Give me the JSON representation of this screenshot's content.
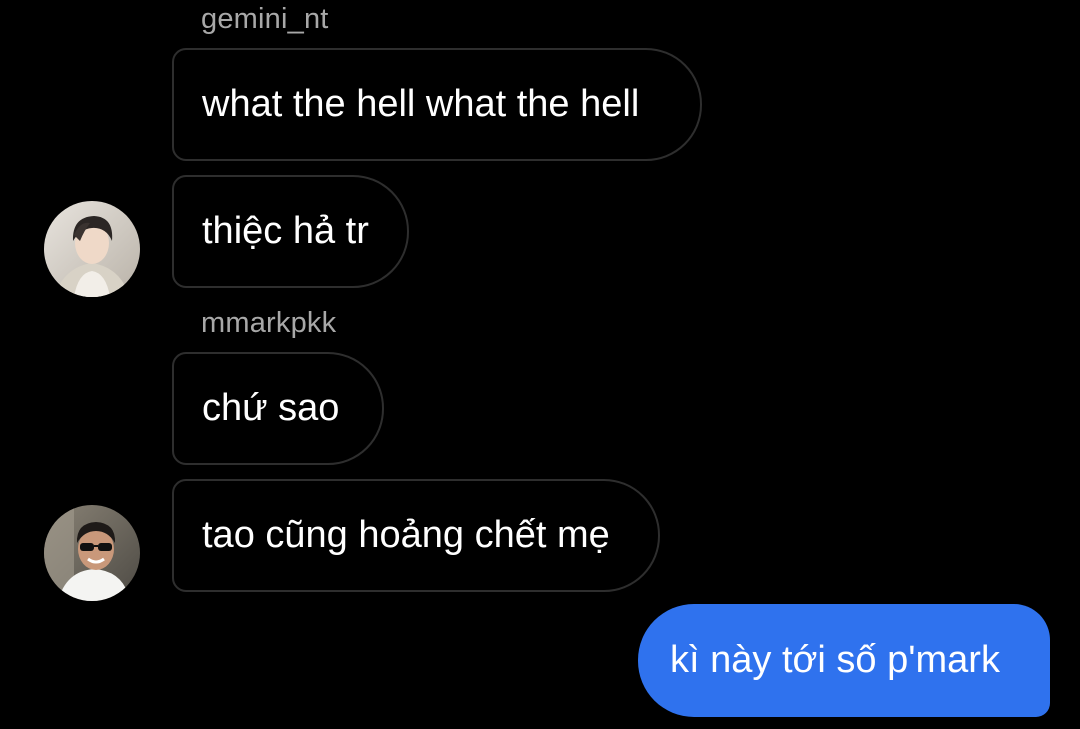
{
  "messages": [
    {
      "type": "sender",
      "text": "gemini_nt"
    },
    {
      "type": "incoming",
      "text": "what the hell what the hell"
    },
    {
      "type": "incoming",
      "text": "thiệc hả tr",
      "avatar": "profile-photo-user-gemini"
    },
    {
      "type": "sender",
      "text": "mmarkpkk"
    },
    {
      "type": "incoming",
      "text": "chứ sao"
    },
    {
      "type": "incoming",
      "text": "tao cũng hoảng chết mẹ",
      "avatar": "profile-photo-user-mmark"
    },
    {
      "type": "outgoing",
      "text": "kì này tới số p'mark"
    }
  ],
  "colors": {
    "background": "#000000",
    "incoming_border": "#2e2e2e",
    "outgoing_bubble": "#2f72ee",
    "sender_name": "#a8a8a8",
    "text": "#ffffff"
  }
}
